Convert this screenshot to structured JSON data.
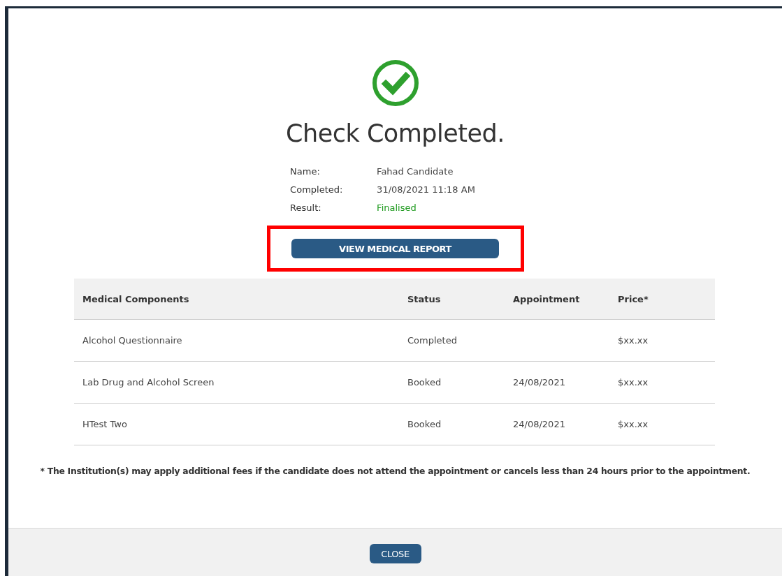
{
  "title": "Check Completed.",
  "details": [
    {
      "label": "Name:",
      "value": "Fahad Candidate",
      "kind": "plain"
    },
    {
      "label": "Completed:",
      "value": "31/08/2021 11:18 AM",
      "kind": "plain"
    },
    {
      "label": "Result:",
      "value": "Finalised",
      "kind": "success"
    }
  ],
  "report_button": "VIEW MEDICAL REPORT",
  "table": {
    "columns": [
      "Medical Components",
      "Status",
      "Appointment",
      "Price*"
    ],
    "rows": [
      [
        "Alcohol Questionnaire",
        "Completed",
        "",
        "$xx.xx"
      ],
      [
        "Lab Drug and Alcohol Screen",
        "Booked",
        "24/08/2021",
        "$xx.xx"
      ],
      [
        "HTest Two",
        "Booked",
        "24/08/2021",
        "$xx.xx"
      ]
    ]
  },
  "footnote": "* The Institution(s) may apply additional fees if the candidate does not attend the appointment or cancels less than 24 hours prior to the appointment.",
  "close_button": "CLOSE"
}
